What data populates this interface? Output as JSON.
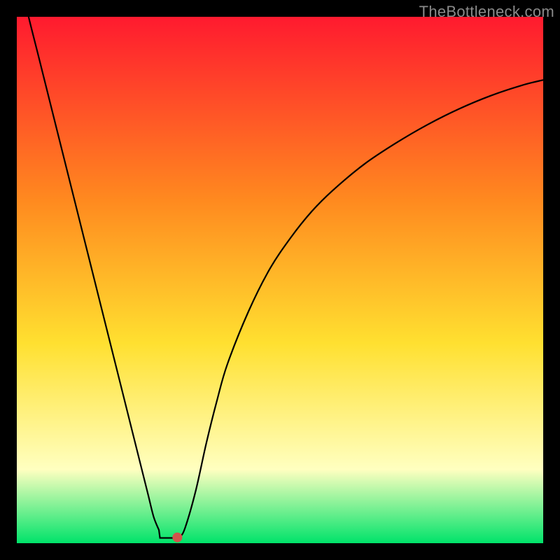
{
  "watermark": "TheBottleneck.com",
  "colors": {
    "gradient_top": "#ff1a2f",
    "gradient_mid1": "#ff8a1f",
    "gradient_mid2": "#ffe030",
    "gradient_light": "#ffffc0",
    "gradient_bottom": "#00e36a",
    "curve": "#000000",
    "marker": "#d1554b",
    "frame": "#000000"
  },
  "chart_data": {
    "type": "line",
    "title": "",
    "xlabel": "",
    "ylabel": "",
    "xlim": [
      0,
      100
    ],
    "ylim": [
      0,
      100
    ],
    "series": [
      {
        "name": "bottleneck-curve",
        "x": [
          0,
          2,
          4,
          6,
          8,
          10,
          12,
          14,
          16,
          18,
          20,
          22,
          24,
          25,
          26,
          27,
          28,
          29,
          30,
          31,
          32,
          34,
          36,
          38,
          40,
          44,
          48,
          52,
          56,
          60,
          66,
          72,
          78,
          84,
          90,
          96,
          100
        ],
        "y": [
          110,
          101,
          93,
          85,
          77,
          69,
          61,
          53,
          45,
          37,
          29,
          21,
          13,
          9,
          5,
          2.5,
          1.2,
          1.0,
          1.0,
          1.2,
          3,
          10,
          19,
          27,
          34,
          44,
          52,
          58,
          63,
          67,
          72,
          76,
          79.5,
          82.5,
          85,
          87,
          88
        ]
      }
    ],
    "marker": {
      "x": 30.5,
      "y": 1.1
    },
    "flat_segment": {
      "x0": 27.2,
      "x1": 30.2,
      "y": 1.0
    }
  }
}
